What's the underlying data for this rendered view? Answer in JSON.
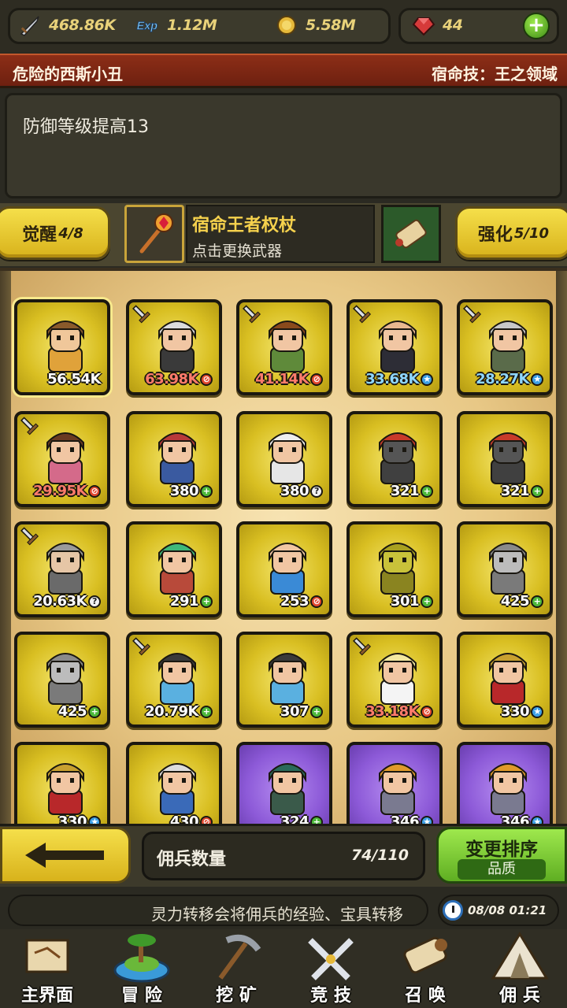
{
  "resources": {
    "attack": "468.86K",
    "exp": "1.12M",
    "gold": "5.58M",
    "gems": "44"
  },
  "destiny": {
    "name": "危险的西斯小丑",
    "skill": "宿命技：王之领域",
    "description": "防御等级提高13"
  },
  "weapon": {
    "awaken_label": "觉醒",
    "awaken_value": "4/8",
    "name": "宿命王者权杖",
    "hint": "点击更换武器",
    "enhance_label": "强化",
    "enhance_value": "5/10"
  },
  "heroes": [
    {
      "level": "56.54K",
      "badge": "",
      "frame": "gold",
      "selected": true,
      "sword": false,
      "color": "#f0c79a",
      "hair": "#8a5a2b",
      "body": "#e0a23a"
    },
    {
      "level": "63.98K",
      "badge": "red",
      "frame": "gold",
      "sword": true,
      "color": "#f1c6a3",
      "hair": "#dcdcdc",
      "body": "#3a3a3a"
    },
    {
      "level": "41.14K",
      "badge": "red",
      "frame": "gold",
      "sword": true,
      "color": "#f1c6a3",
      "hair": "#8a4a1c",
      "body": "#5f8a3a"
    },
    {
      "level": "33.68K",
      "badge": "blue",
      "frame": "gold",
      "sword": true,
      "color": "#f1c6a3",
      "hair": "#e8b890",
      "body": "#2d2d36"
    },
    {
      "level": "28.27K",
      "badge": "blue",
      "frame": "gold",
      "sword": true,
      "color": "#f1c6a3",
      "hair": "#c8c8c8",
      "body": "#5a6b4a"
    },
    {
      "level": "29.95K",
      "badge": "red",
      "frame": "gold",
      "sword": true,
      "color": "#f1c6a3",
      "hair": "#6a3a22",
      "body": "#d46a8a"
    },
    {
      "level": "380",
      "badge": "green",
      "frame": "gold",
      "sword": false,
      "color": "#f1c6a3",
      "hair": "#b83a3a",
      "body": "#3a5aa0"
    },
    {
      "level": "380",
      "badge": "gray",
      "frame": "gold",
      "sword": false,
      "color": "#f1c6a3",
      "hair": "#eeeeee",
      "body": "#e6e6e6"
    },
    {
      "level": "321",
      "badge": "green",
      "frame": "gold",
      "sword": false,
      "color": "#555555",
      "hair": "#c83a2a",
      "body": "#404040"
    },
    {
      "level": "321",
      "badge": "green",
      "frame": "gold",
      "sword": false,
      "color": "#555555",
      "hair": "#c83a2a",
      "body": "#404040"
    },
    {
      "level": "20.63K",
      "badge": "gray",
      "frame": "gold",
      "sword": true,
      "color": "#e6c6a6",
      "hair": "#9a9a9a",
      "body": "#6a6a6a"
    },
    {
      "level": "291",
      "badge": "green",
      "frame": "gold",
      "sword": false,
      "color": "#f1c6a3",
      "hair": "#3fb87a",
      "body": "#b84a3a"
    },
    {
      "level": "253",
      "badge": "red",
      "frame": "gold",
      "sword": false,
      "color": "#f1c6a3",
      "hair": "#f1c6a3",
      "body": "#3a8ad6"
    },
    {
      "level": "301",
      "badge": "green",
      "frame": "gold",
      "sword": false,
      "color": "#c9c23a",
      "hair": "#a8a020",
      "body": "#8a8420"
    },
    {
      "level": "425",
      "badge": "green",
      "frame": "gold",
      "sword": false,
      "color": "#bcbcbc",
      "hair": "#8a8a8a",
      "body": "#7a7a7a"
    },
    {
      "level": "425",
      "badge": "green",
      "frame": "gold",
      "sword": false,
      "color": "#bcbcbc",
      "hair": "#8a8a8a",
      "body": "#7a7a7a"
    },
    {
      "level": "20.79K",
      "badge": "green",
      "frame": "gold",
      "sword": true,
      "color": "#f1c6a3",
      "hair": "#3a3a3a",
      "body": "#5ab0e0"
    },
    {
      "level": "307",
      "badge": "green",
      "frame": "gold",
      "sword": false,
      "color": "#f1c6a3",
      "hair": "#3a3a3a",
      "body": "#5ab0e0"
    },
    {
      "level": "33.18K",
      "badge": "red",
      "frame": "gold",
      "sword": true,
      "color": "#f1c6a3",
      "hair": "#f3e8a0",
      "body": "#f4f4f4"
    },
    {
      "level": "330",
      "badge": "blue",
      "frame": "gold",
      "sword": false,
      "color": "#f1c6a3",
      "hair": "#c8a030",
      "body": "#b8282a"
    },
    {
      "level": "330",
      "badge": "blue",
      "frame": "gold",
      "sword": false,
      "color": "#f1c6a3",
      "hair": "#c8a030",
      "body": "#b8282a"
    },
    {
      "level": "430",
      "badge": "red",
      "frame": "gold",
      "sword": false,
      "color": "#f1c6a3",
      "hair": "#dcdcdc",
      "body": "#3a6ab8"
    },
    {
      "level": "324",
      "badge": "green",
      "frame": "purple",
      "sword": false,
      "color": "#f1c6a3",
      "hair": "#2a6a5a",
      "body": "#3a5a4a"
    },
    {
      "level": "346",
      "badge": "blue",
      "frame": "purple",
      "sword": false,
      "color": "#f1c6a3",
      "hair": "#e09a2a",
      "body": "#7a7a90"
    },
    {
      "level": "346",
      "badge": "blue",
      "frame": "purple",
      "sword": false,
      "color": "#f1c6a3",
      "hair": "#e09a2a",
      "body": "#7a7a90"
    }
  ],
  "controls": {
    "count_label": "佣兵数量",
    "count_value": "74/110",
    "sort_label": "变更排序",
    "sort_mode": "品质"
  },
  "ticker": "灵力转移会将佣兵的经验、宝具转移",
  "clock": "08/08 01:21",
  "nav": [
    {
      "label": "主界面",
      "icon": "map-scroll-icon"
    },
    {
      "label": "冒 险",
      "icon": "island-icon"
    },
    {
      "label": "挖 矿",
      "icon": "pickaxe-icon"
    },
    {
      "label": "竞 技",
      "icon": "crossed-swords-icon"
    },
    {
      "label": "召 唤",
      "icon": "summon-scroll-icon"
    },
    {
      "label": "佣 兵",
      "icon": "tent-icon"
    }
  ]
}
